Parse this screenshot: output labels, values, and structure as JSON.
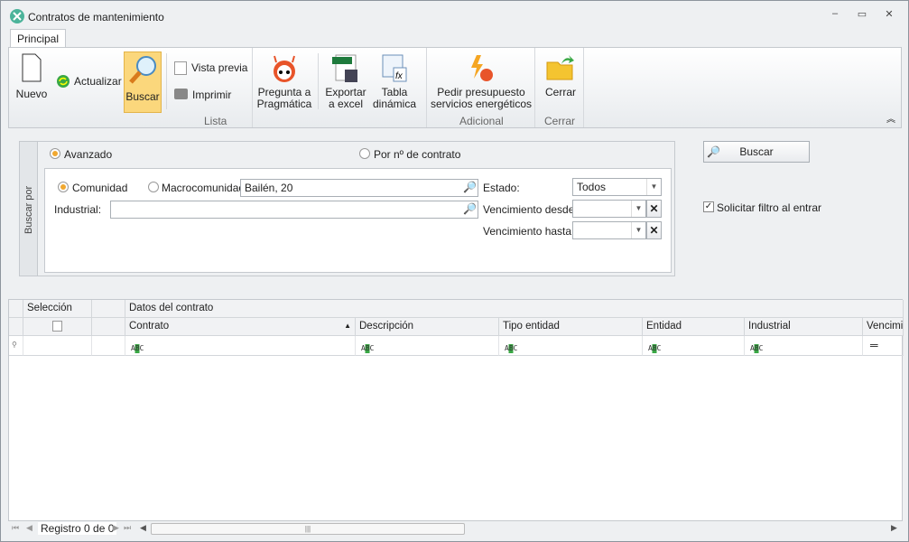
{
  "window": {
    "title": "Contratos de mantenimiento",
    "minimize": "‒",
    "restore": "▭",
    "close": "✕"
  },
  "ribbon": {
    "tab": "Principal",
    "buttons": {
      "nuevo": "Nuevo",
      "actualizar": "Actualizar",
      "buscar": "Buscar",
      "vista_previa": "Vista previa",
      "imprimir": "Imprimir",
      "pregunta": [
        "Pregunta a",
        "Pragmática"
      ],
      "exportar": [
        "Exportar",
        "a excel"
      ],
      "tabla": [
        "Tabla",
        "dinámica"
      ],
      "pedir": [
        "Pedir presupuesto",
        "servicios energéticos"
      ],
      "cerrar": "Cerrar"
    },
    "groups": {
      "lista": "Lista",
      "adicional": "Adicional",
      "cerrar": "Cerrar"
    },
    "collapse": "︽"
  },
  "search": {
    "group_label": "Buscar por",
    "mode_avanzado": "Avanzado",
    "mode_contrato": "Por nº de contrato",
    "selected_mode": "Avanzado",
    "comunidad": "Comunidad",
    "macrocomunidad": "Macrocomunidad",
    "selected_scope": "Comunidad",
    "comunidad_value": "Bailén, 20",
    "industrial_label": "Industrial:",
    "industrial_value": "",
    "estado_label": "Estado:",
    "estado_value": "Todos",
    "venc_desde_label": "Vencimiento desde:",
    "venc_desde_value": "",
    "venc_hasta_label": "Vencimiento hasta:",
    "venc_hasta_value": "",
    "buscar_button": "Buscar",
    "solicitar_filtro": "Solicitar filtro al entrar",
    "solicitar_filtro_checked": true
  },
  "grid": {
    "band_seleccion": "Selección",
    "band_datos": "Datos del contrato",
    "columns": [
      "Contrato",
      "Descripción",
      "Tipo entidad",
      "Entidad",
      "Industrial",
      "Vencimie"
    ],
    "sort_column": "Contrato",
    "sort_dir": "ascending",
    "filter_glyph": "ABC",
    "rows": []
  },
  "footer": {
    "record": "Registro 0 de 0"
  }
}
